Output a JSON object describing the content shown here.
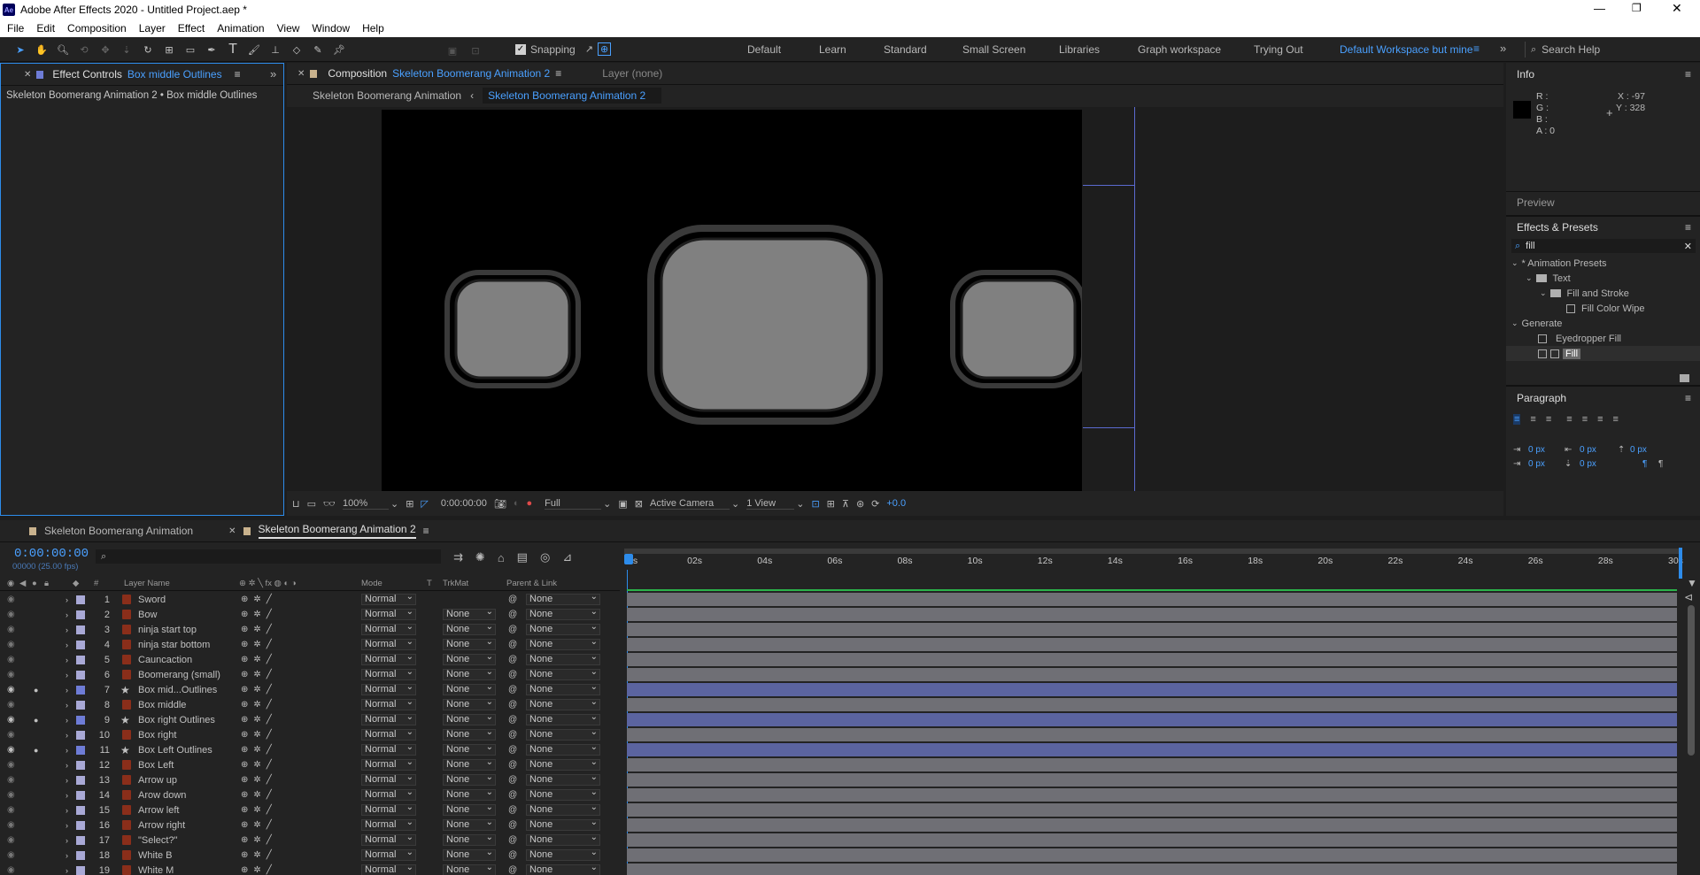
{
  "app": {
    "title": "Adobe After Effects 2020 - Untitled Project.aep *",
    "logo": "Ae"
  },
  "menu": [
    "File",
    "Edit",
    "Composition",
    "Layer",
    "Effect",
    "Animation",
    "View",
    "Window",
    "Help"
  ],
  "toolbar": {
    "snapping": "Snapping",
    "search_placeholder": "Search Help"
  },
  "workspaces": [
    "Default",
    "Learn",
    "Standard",
    "Small Screen",
    "Libraries",
    "Graph workspace",
    "Trying Out",
    "Default Workspace but mine"
  ],
  "effect_controls": {
    "tab": "Effect Controls",
    "layer": "Box middle Outlines",
    "breadcrumb": "Skeleton Boomerang Animation 2 • Box middle Outlines"
  },
  "composition": {
    "tab": "Composition",
    "name": "Skeleton Boomerang Animation 2",
    "layer_tab": "Layer  (none)",
    "crumbs": [
      "Skeleton Boomerang Animation",
      "Skeleton Boomerang Animation 2"
    ],
    "zoom": "100%",
    "time": "0:00:00:00",
    "resolution": "Full",
    "camera": "Active Camera",
    "views": "1 View",
    "exposure": "+0.0"
  },
  "info": {
    "title": "Info",
    "r": "R :",
    "g": "G :",
    "b": "B :",
    "a": "A :  0",
    "x": "X : -97",
    "y": "Y : 328"
  },
  "preview": {
    "title": "Preview"
  },
  "effects_presets": {
    "title": "Effects & Presets",
    "search": "fill",
    "tree": [
      {
        "label": "* Animation Presets",
        "level": 0,
        "type": "group"
      },
      {
        "label": "Text",
        "level": 1,
        "type": "folder"
      },
      {
        "label": "Fill and Stroke",
        "level": 2,
        "type": "folder"
      },
      {
        "label": "Fill Color Wipe",
        "level": 3,
        "type": "preset"
      },
      {
        "label": "Generate",
        "level": 0,
        "type": "group"
      },
      {
        "label": "Eyedropper Fill",
        "level": 1,
        "type": "effect"
      },
      {
        "label": "Fill",
        "level": 1,
        "type": "effect-selected"
      }
    ]
  },
  "paragraph": {
    "title": "Paragraph",
    "v1": "0 px",
    "v2": "0 px",
    "v3": "0 px",
    "v4": "0 px",
    "v5": "0 px"
  },
  "timeline": {
    "tabs": [
      "Skeleton Boomerang Animation",
      "Skeleton Boomerang Animation 2"
    ],
    "timecode": "0:00:00:00",
    "fps": "00000 (25.00 fps)",
    "ruler": [
      "0s",
      "02s",
      "04s",
      "06s",
      "08s",
      "10s",
      "12s",
      "14s",
      "16s",
      "18s",
      "20s",
      "22s",
      "24s",
      "26s",
      "28s",
      "30s"
    ],
    "headers": {
      "num": "#",
      "layer": "Layer Name",
      "mode": "Mode",
      "t": "T",
      "trkmat": "TrkMat",
      "parent": "Parent & Link"
    },
    "layers": [
      {
        "num": "1",
        "name": "Sword",
        "mode": "Normal",
        "trkmat": "",
        "parent": "None",
        "shape": false,
        "vis": false
      },
      {
        "num": "2",
        "name": "Bow",
        "mode": "Normal",
        "trkmat": "None",
        "parent": "None",
        "shape": false,
        "vis": false
      },
      {
        "num": "3",
        "name": "ninja start top",
        "mode": "Normal",
        "trkmat": "None",
        "parent": "None",
        "shape": false,
        "vis": false
      },
      {
        "num": "4",
        "name": "ninja star bottom",
        "mode": "Normal",
        "trkmat": "None",
        "parent": "None",
        "shape": false,
        "vis": false
      },
      {
        "num": "5",
        "name": "Cauncaction",
        "mode": "Normal",
        "trkmat": "None",
        "parent": "None",
        "shape": false,
        "vis": false
      },
      {
        "num": "6",
        "name": "Boomerang (small)",
        "mode": "Normal",
        "trkmat": "None",
        "parent": "None",
        "shape": false,
        "vis": false
      },
      {
        "num": "7",
        "name": "Box mid...Outlines",
        "mode": "Normal",
        "trkmat": "None",
        "parent": "None",
        "shape": true,
        "vis": true
      },
      {
        "num": "8",
        "name": "Box middle",
        "mode": "Normal",
        "trkmat": "None",
        "parent": "None",
        "shape": false,
        "vis": false
      },
      {
        "num": "9",
        "name": "Box right Outlines",
        "mode": "Normal",
        "trkmat": "None",
        "parent": "None",
        "shape": true,
        "vis": true
      },
      {
        "num": "10",
        "name": "Box right",
        "mode": "Normal",
        "trkmat": "None",
        "parent": "None",
        "shape": false,
        "vis": false
      },
      {
        "num": "11",
        "name": "Box Left Outlines",
        "mode": "Normal",
        "trkmat": "None",
        "parent": "None",
        "shape": true,
        "vis": true
      },
      {
        "num": "12",
        "name": "Box Left",
        "mode": "Normal",
        "trkmat": "None",
        "parent": "None",
        "shape": false,
        "vis": false
      },
      {
        "num": "13",
        "name": "Arrow up",
        "mode": "Normal",
        "trkmat": "None",
        "parent": "None",
        "shape": false,
        "vis": false
      },
      {
        "num": "14",
        "name": "Arow down",
        "mode": "Normal",
        "trkmat": "None",
        "parent": "None",
        "shape": false,
        "vis": false
      },
      {
        "num": "15",
        "name": "Arrow left",
        "mode": "Normal",
        "trkmat": "None",
        "parent": "None",
        "shape": false,
        "vis": false
      },
      {
        "num": "16",
        "name": "Arrow right",
        "mode": "Normal",
        "trkmat": "None",
        "parent": "None",
        "shape": false,
        "vis": false
      },
      {
        "num": "17",
        "name": "\"Select?\"",
        "mode": "Normal",
        "trkmat": "None",
        "parent": "None",
        "shape": false,
        "vis": false
      },
      {
        "num": "18",
        "name": "White B",
        "mode": "Normal",
        "trkmat": "None",
        "parent": "None",
        "shape": false,
        "vis": false
      },
      {
        "num": "19",
        "name": "White M",
        "mode": "Normal",
        "trkmat": "None",
        "parent": "None",
        "shape": false,
        "vis": false
      }
    ]
  },
  "colors": {
    "accent": "#2d8ceb",
    "panel": "#232323",
    "layer_label": "#a9a9d6",
    "selected_bar": "#5b64a0",
    "bar": "#6f6f75"
  }
}
